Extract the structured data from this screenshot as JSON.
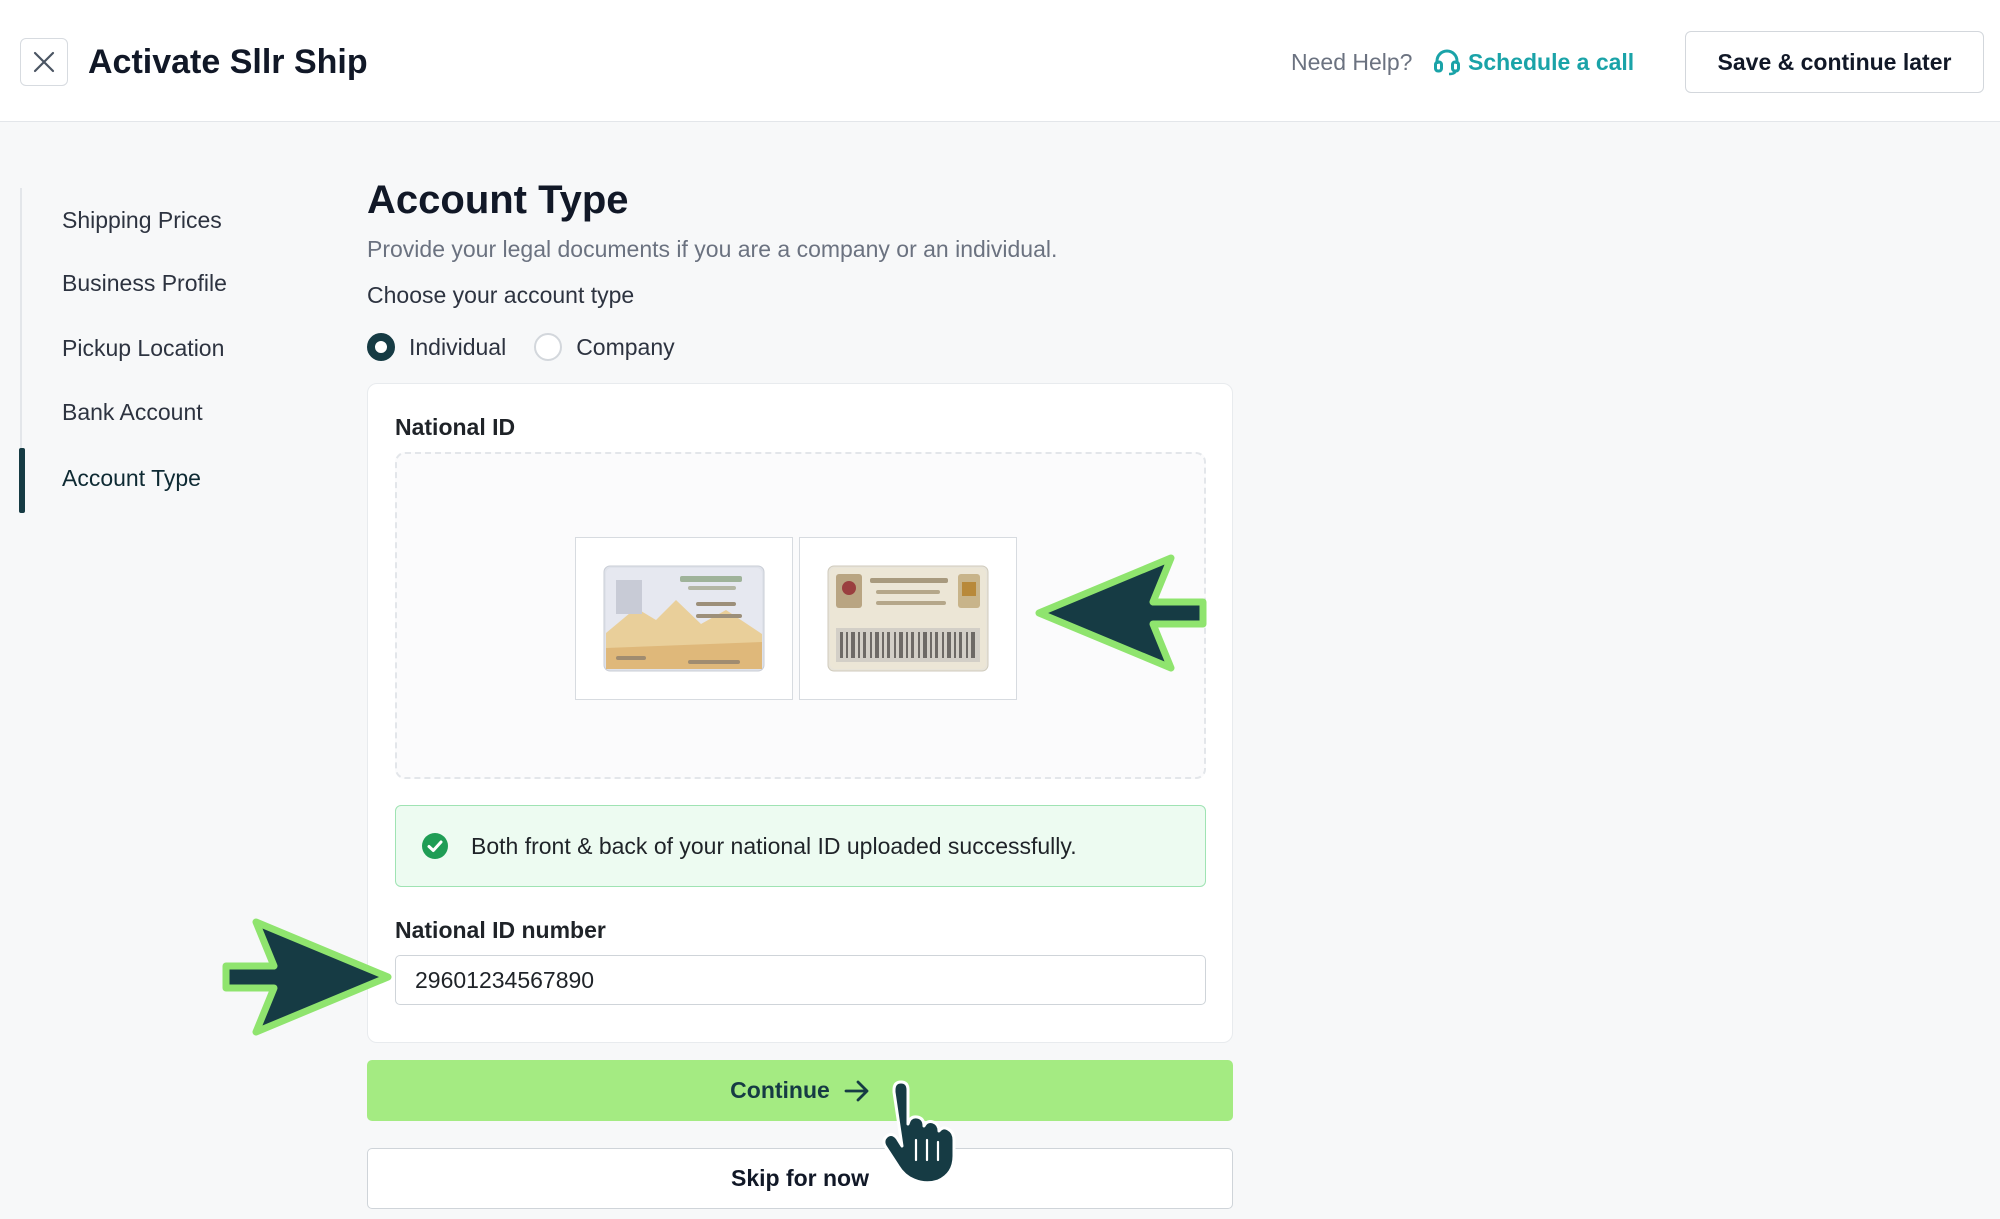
{
  "header": {
    "title": "Activate Sllr Ship",
    "need_help": "Need Help?",
    "schedule_call": "Schedule a call",
    "save_later": "Save & continue later"
  },
  "sidebar": {
    "items": [
      {
        "label": "Shipping Prices",
        "active": false
      },
      {
        "label": "Business Profile",
        "active": false
      },
      {
        "label": "Pickup Location",
        "active": false
      },
      {
        "label": "Bank Account",
        "active": false
      },
      {
        "label": "Account Type",
        "active": true
      }
    ]
  },
  "main": {
    "title": "Account Type",
    "subtitle": "Provide your legal documents if you are a company or an individual.",
    "choose_label": "Choose your account type",
    "account_types": [
      {
        "label": "Individual",
        "selected": true
      },
      {
        "label": "Company",
        "selected": false
      }
    ],
    "national_id_label": "National ID",
    "uploads": [
      {
        "name": "national-id-front",
        "icon": "id-card-front-image"
      },
      {
        "name": "national-id-back",
        "icon": "id-card-back-image"
      }
    ],
    "success_message": "Both front & back of your national ID uploaded successfully.",
    "id_number_label": "National ID number",
    "id_number_value": "29601234567890",
    "continue_label": "Continue",
    "skip_label": "Skip for now"
  },
  "colors": {
    "accent_teal": "#1aa3a8",
    "primary_dark": "#163b44",
    "continue_green": "#a4eb82",
    "success_bg": "#edfbf1",
    "success_check": "#1f9d55"
  }
}
